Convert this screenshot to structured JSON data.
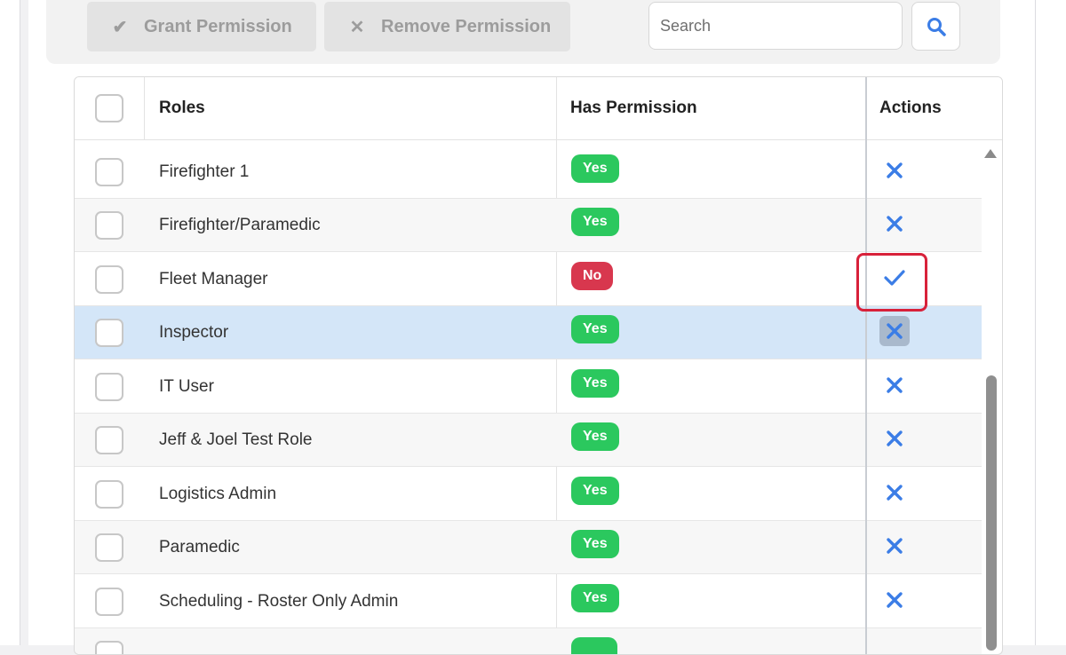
{
  "toolbar": {
    "grant_label": "Grant Permission",
    "remove_label": "Remove Permission",
    "search_placeholder": "Search"
  },
  "table": {
    "columns": {
      "roles": "Roles",
      "has_permission": "Has Permission",
      "actions": "Actions"
    },
    "rows": [
      {
        "role": "Firefighter 1",
        "permission": "Yes",
        "action": "remove-icon"
      },
      {
        "role": "Firefighter/Paramedic",
        "permission": "Yes",
        "action": "remove-icon"
      },
      {
        "role": "Fleet Manager",
        "permission": "No",
        "action": "check-icon"
      },
      {
        "role": "Inspector",
        "permission": "Yes",
        "action": "remove-icon"
      },
      {
        "role": "IT User",
        "permission": "Yes",
        "action": "remove-icon"
      },
      {
        "role": "Jeff & Joel Test Role",
        "permission": "Yes",
        "action": "remove-icon"
      },
      {
        "role": "Logistics Admin",
        "permission": "Yes",
        "action": "remove-icon"
      },
      {
        "role": "Paramedic",
        "permission": "Yes",
        "action": "remove-icon"
      },
      {
        "role": "Scheduling - Roster Only Admin",
        "permission": "Yes",
        "action": "remove-icon"
      }
    ]
  },
  "colors": {
    "yes_badge": "#2bc85e",
    "no_badge": "#d8374e",
    "action_icon": "#3b7de6",
    "selected_row": "#d4e6f8",
    "highlight_box": "#d8213a"
  }
}
